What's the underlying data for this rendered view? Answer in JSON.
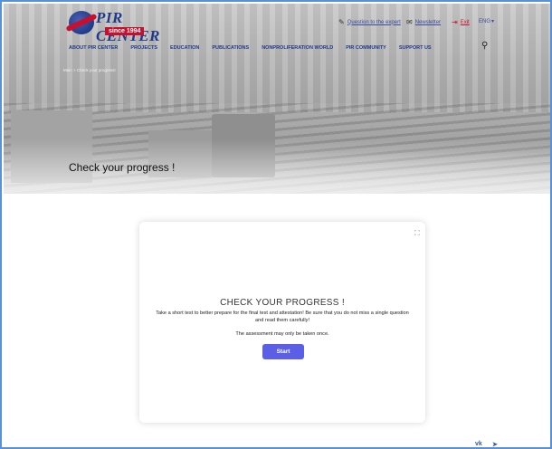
{
  "logo": {
    "name": "PIR CENTER",
    "since": "since 1994"
  },
  "utility": {
    "question_label": "Question to the expert",
    "newsletter_label": "Newsletter",
    "exit_label": "Exit",
    "lang_label": "ENG",
    "lang_chevron": "▾"
  },
  "nav": {
    "items": [
      {
        "label": "ABOUT PIR CENTER"
      },
      {
        "label": "PROJECTS"
      },
      {
        "label": "EDUCATION"
      },
      {
        "label": "PUBLICATIONS"
      },
      {
        "label": "NONPROLIFERATION WORLD"
      },
      {
        "label": "PIR COMMUNITY"
      },
      {
        "label": "SUPPORT US"
      }
    ]
  },
  "breadcrumb": "Main > Check your progress!",
  "hero": {
    "title": "Check your progress !"
  },
  "card": {
    "title": "CHECK YOUR PROGRESS !",
    "description": "Take a short test to better prepare for the final test and attestation! Be sure that you do not miss a single question and read them carefully!",
    "note": "The assessment may only be taken once.",
    "start_label": "Start"
  },
  "icons": {
    "pencil": "✎",
    "mail": "✉",
    "exit": "⇥",
    "search": "⚲",
    "expand": "⛶",
    "vk": "vk",
    "telegram": "➤"
  },
  "colors": {
    "brand_blue": "#1f3a8a",
    "brand_red": "#c8102e",
    "button": "#5b5fe6"
  }
}
